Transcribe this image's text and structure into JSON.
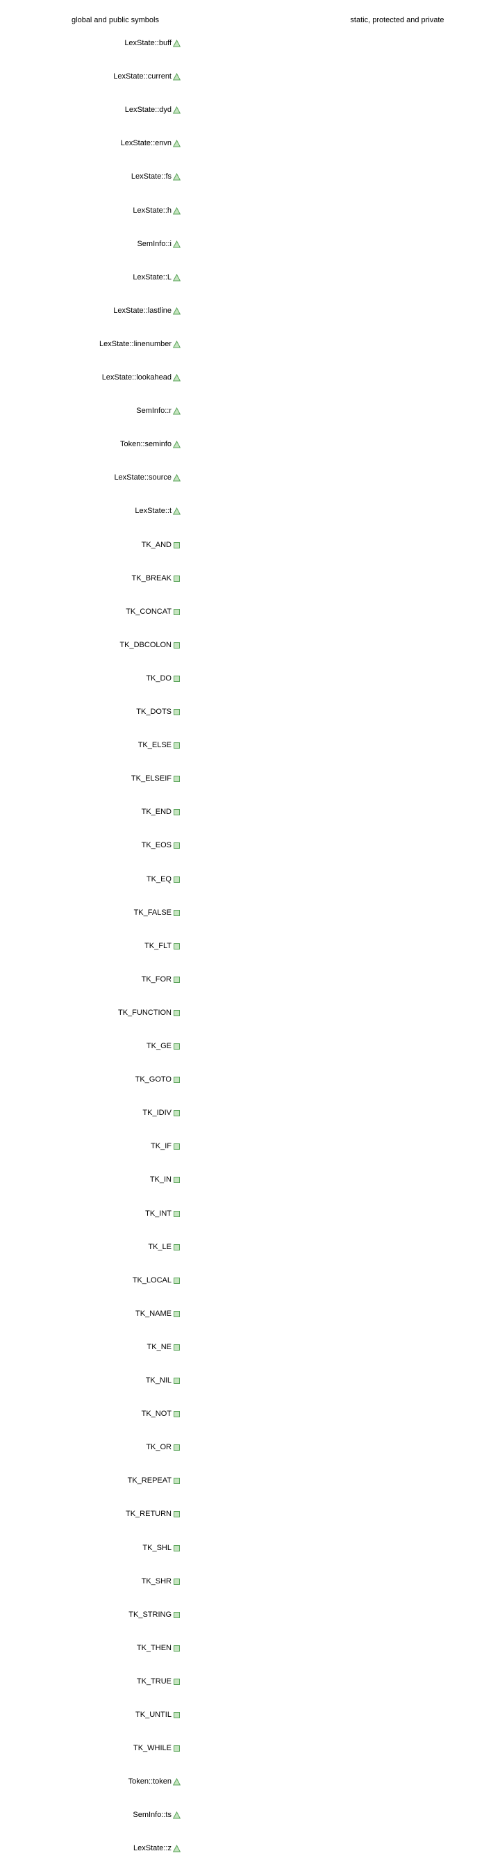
{
  "headers": {
    "left": "global and public symbols",
    "right": "static, protected and private"
  },
  "symbol_kinds": {
    "member": {
      "icon": "triangle-icon",
      "fill": "#c6e5c0",
      "stroke": "#5aa35a"
    },
    "enum": {
      "icon": "square-icon",
      "fill": "#c6e5c0",
      "stroke": "#5aa35a"
    }
  },
  "symbols": [
    {
      "label": "LexState::buff",
      "kind": "member"
    },
    {
      "label": "LexState::current",
      "kind": "member"
    },
    {
      "label": "LexState::dyd",
      "kind": "member"
    },
    {
      "label": "LexState::envn",
      "kind": "member"
    },
    {
      "label": "LexState::fs",
      "kind": "member"
    },
    {
      "label": "LexState::h",
      "kind": "member"
    },
    {
      "label": "SemInfo::i",
      "kind": "member"
    },
    {
      "label": "LexState::L",
      "kind": "member"
    },
    {
      "label": "LexState::lastline",
      "kind": "member"
    },
    {
      "label": "LexState::linenumber",
      "kind": "member"
    },
    {
      "label": "LexState::lookahead",
      "kind": "member"
    },
    {
      "label": "SemInfo::r",
      "kind": "member"
    },
    {
      "label": "Token::seminfo",
      "kind": "member"
    },
    {
      "label": "LexState::source",
      "kind": "member"
    },
    {
      "label": "LexState::t",
      "kind": "member"
    },
    {
      "label": "TK_AND",
      "kind": "enum"
    },
    {
      "label": "TK_BREAK",
      "kind": "enum"
    },
    {
      "label": "TK_CONCAT",
      "kind": "enum"
    },
    {
      "label": "TK_DBCOLON",
      "kind": "enum"
    },
    {
      "label": "TK_DO",
      "kind": "enum"
    },
    {
      "label": "TK_DOTS",
      "kind": "enum"
    },
    {
      "label": "TK_ELSE",
      "kind": "enum"
    },
    {
      "label": "TK_ELSEIF",
      "kind": "enum"
    },
    {
      "label": "TK_END",
      "kind": "enum"
    },
    {
      "label": "TK_EOS",
      "kind": "enum"
    },
    {
      "label": "TK_EQ",
      "kind": "enum"
    },
    {
      "label": "TK_FALSE",
      "kind": "enum"
    },
    {
      "label": "TK_FLT",
      "kind": "enum"
    },
    {
      "label": "TK_FOR",
      "kind": "enum"
    },
    {
      "label": "TK_FUNCTION",
      "kind": "enum"
    },
    {
      "label": "TK_GE",
      "kind": "enum"
    },
    {
      "label": "TK_GOTO",
      "kind": "enum"
    },
    {
      "label": "TK_IDIV",
      "kind": "enum"
    },
    {
      "label": "TK_IF",
      "kind": "enum"
    },
    {
      "label": "TK_IN",
      "kind": "enum"
    },
    {
      "label": "TK_INT",
      "kind": "enum"
    },
    {
      "label": "TK_LE",
      "kind": "enum"
    },
    {
      "label": "TK_LOCAL",
      "kind": "enum"
    },
    {
      "label": "TK_NAME",
      "kind": "enum"
    },
    {
      "label": "TK_NE",
      "kind": "enum"
    },
    {
      "label": "TK_NIL",
      "kind": "enum"
    },
    {
      "label": "TK_NOT",
      "kind": "enum"
    },
    {
      "label": "TK_OR",
      "kind": "enum"
    },
    {
      "label": "TK_REPEAT",
      "kind": "enum"
    },
    {
      "label": "TK_RETURN",
      "kind": "enum"
    },
    {
      "label": "TK_SHL",
      "kind": "enum"
    },
    {
      "label": "TK_SHR",
      "kind": "enum"
    },
    {
      "label": "TK_STRING",
      "kind": "enum"
    },
    {
      "label": "TK_THEN",
      "kind": "enum"
    },
    {
      "label": "TK_TRUE",
      "kind": "enum"
    },
    {
      "label": "TK_UNTIL",
      "kind": "enum"
    },
    {
      "label": "TK_WHILE",
      "kind": "enum"
    },
    {
      "label": "Token::token",
      "kind": "member"
    },
    {
      "label": "SemInfo::ts",
      "kind": "member"
    },
    {
      "label": "LexState::z",
      "kind": "member"
    }
  ]
}
